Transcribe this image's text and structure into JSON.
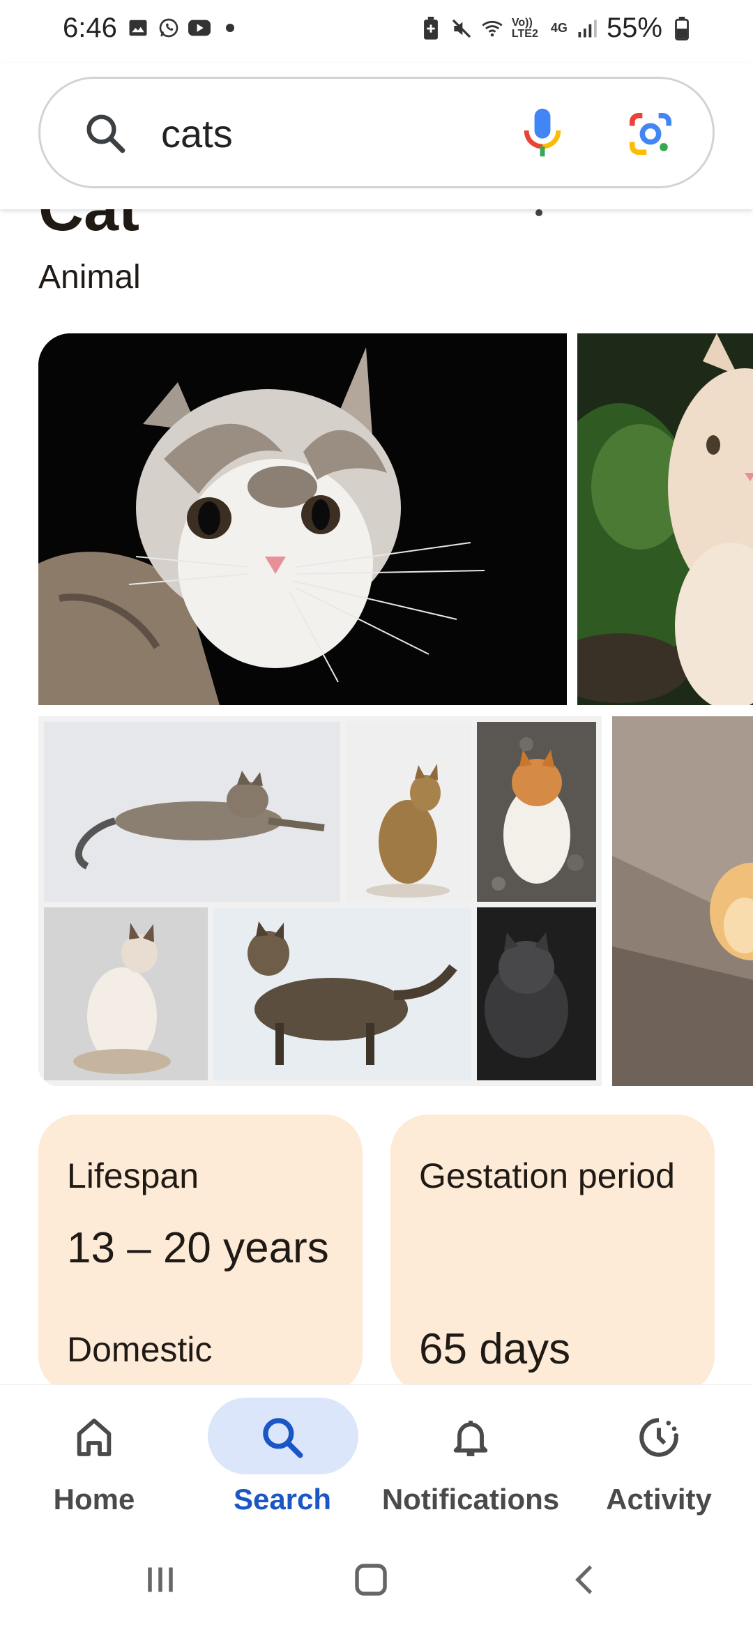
{
  "status_bar": {
    "time": "6:46",
    "left_icons": [
      "gallery-icon",
      "whatsapp-icon",
      "youtube-icon",
      "dot-icon"
    ],
    "right_icons": [
      "battery-saver-icon",
      "mute-icon",
      "wifi-icon",
      "volte-icon",
      "4g-icon",
      "signal-icon"
    ],
    "volte_text": "Vo)) LTE2",
    "network_text": "4G",
    "battery": "55%"
  },
  "search": {
    "query": "cats",
    "icons": [
      "search-icon",
      "mic-icon",
      "google-lens-icon"
    ]
  },
  "knowledge_panel": {
    "title": "Cat",
    "subtitle": "Animal",
    "images": [
      {
        "name": "cat-image-1"
      },
      {
        "name": "cat-image-2"
      },
      {
        "name": "cat-breeds-collage"
      },
      {
        "name": "cat-image-4"
      }
    ]
  },
  "facts": [
    {
      "label": "Lifespan",
      "value": "13 – 20 years",
      "sub": "Domestic"
    },
    {
      "label": "Gestation period",
      "value": "65 days"
    }
  ],
  "bottom_nav": {
    "active": "Search",
    "items": [
      {
        "label": "Home",
        "icon": "home-icon"
      },
      {
        "label": "Search",
        "icon": "search-icon"
      },
      {
        "label": "Notifications",
        "icon": "bell-icon"
      },
      {
        "label": "Activity",
        "icon": "activity-icon"
      }
    ]
  },
  "colors": {
    "accent": "#1a56c4",
    "active_pill": "#dce6fb",
    "card_bg": "#fdebd8",
    "text": "#201a15"
  }
}
